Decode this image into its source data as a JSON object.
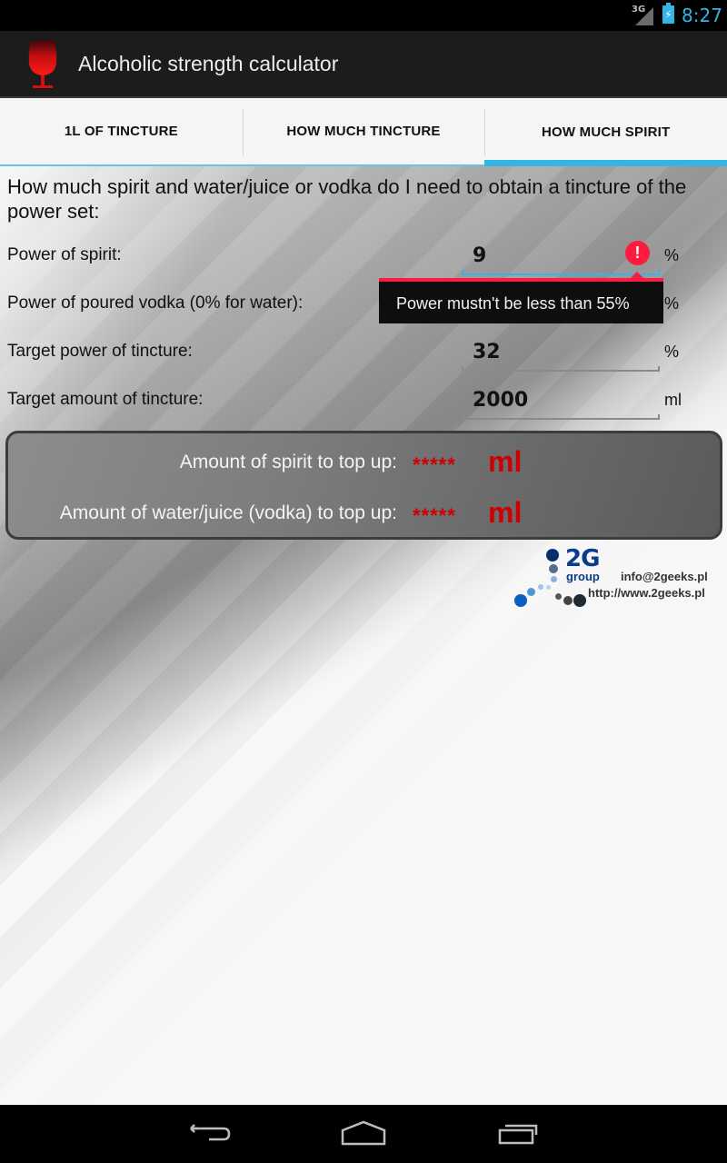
{
  "status_bar": {
    "network": "3G",
    "time": "8:27"
  },
  "app": {
    "title": "Alcoholic strength calculator",
    "icon": "wine-glass-icon"
  },
  "tabs": [
    {
      "label": "1L OF TINCTURE",
      "active": false
    },
    {
      "label": "HOW MUCH TINCTURE",
      "active": false
    },
    {
      "label": "HOW MUCH SPIRIT",
      "active": true
    }
  ],
  "form": {
    "intro": "How much spirit and water/juice or vodka do I need to obtain a tincture of the power set:",
    "fields": [
      {
        "label": "Power of spirit:",
        "value": "9",
        "unit": "%",
        "has_error": true
      },
      {
        "label": "Power of poured vodka (0% for water):",
        "value": "",
        "unit": "%"
      },
      {
        "label": "Target power of tincture:",
        "value": "32",
        "unit": "%"
      },
      {
        "label": "Target amount of tincture:",
        "value": "2000",
        "unit": "ml"
      }
    ],
    "error_message": "Power mustn't be less than 55%"
  },
  "results": [
    {
      "label": "Amount of spirit to top up:",
      "value": "*****",
      "unit": "ml"
    },
    {
      "label": "Amount of water/juice (vodka) to top up:",
      "value": "*****",
      "unit": "ml"
    }
  ],
  "footer_logo": {
    "brand": "2G",
    "sub": "group",
    "email": "info@2geeks.pl",
    "url": "http://www.2geeks.pl"
  },
  "colors": {
    "accent": "#33b5e5",
    "error": "#ff1a3f",
    "result_value": "#cc0000"
  }
}
